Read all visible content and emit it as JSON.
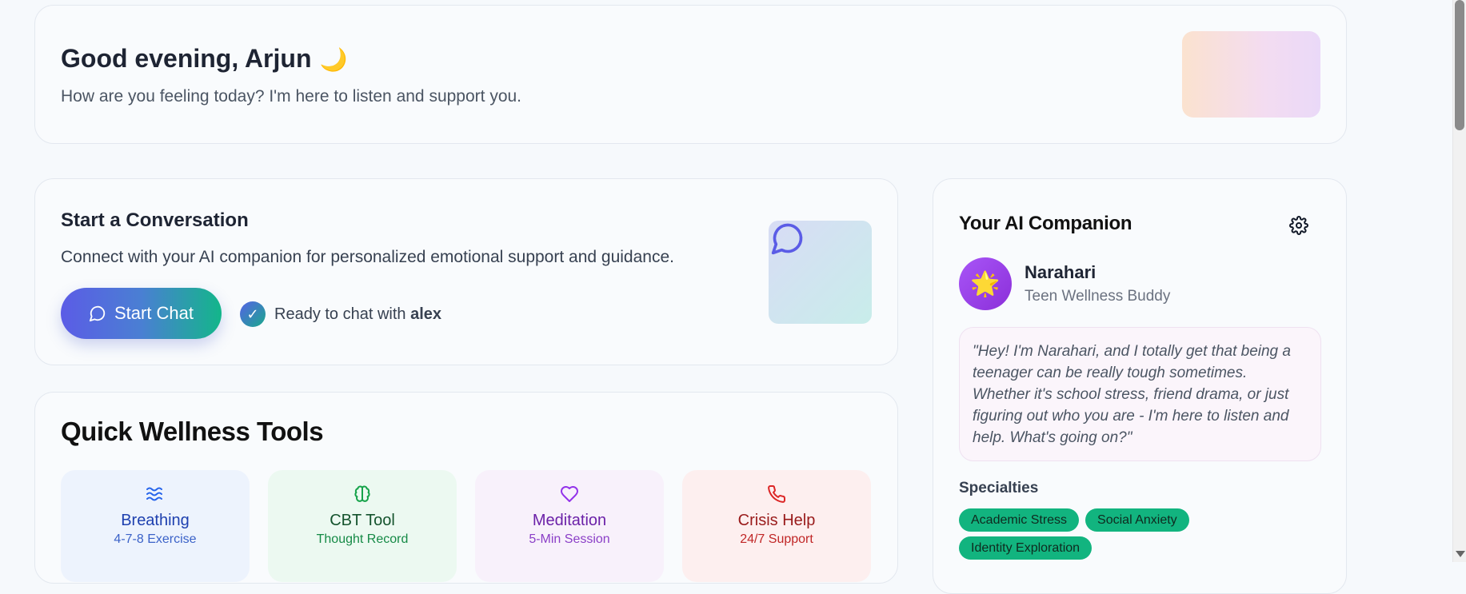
{
  "greeting": {
    "title": "Good evening, Arjun",
    "emoji": "🌙",
    "subtitle": "How are you feeling today? I'm here to listen and support you."
  },
  "conversation": {
    "title": "Start a Conversation",
    "description": "Connect with your AI companion for personalized emotional support and guidance.",
    "button_label": "Start Chat",
    "ready_prefix": "Ready to chat with ",
    "ready_name": "alex",
    "check_glyph": "✓"
  },
  "tools": {
    "title": "Quick Wellness Tools",
    "items": [
      {
        "name": "Breathing",
        "subtitle": "4-7-8 Exercise",
        "icon": "waves-icon",
        "color": "#2563eb"
      },
      {
        "name": "CBT Tool",
        "subtitle": "Thought Record",
        "icon": "brain-icon",
        "color": "#16a34a"
      },
      {
        "name": "Meditation",
        "subtitle": "5-Min Session",
        "icon": "heart-icon",
        "color": "#9333ea"
      },
      {
        "name": "Crisis Help",
        "subtitle": "24/7 Support",
        "icon": "phone-icon",
        "color": "#dc2626"
      }
    ]
  },
  "companion": {
    "title": "Your AI Companion",
    "avatar_emoji": "🌟",
    "name": "Narahari",
    "role": "Teen Wellness Buddy",
    "quote": "\"Hey! I'm Narahari, and I totally get that being a teenager can be really tough sometimes. Whether it's school stress, friend drama, or just figuring out who you are - I'm here to listen and help. What's going on?\"",
    "specialties_label": "Specialties",
    "specialties": [
      "Academic Stress",
      "Social Anxiety",
      "Identity Exploration"
    ]
  },
  "colors": {
    "accent_gradient_start": "#5b5ce6",
    "accent_gradient_end": "#13b68a",
    "tag_green": "#12b47f"
  }
}
